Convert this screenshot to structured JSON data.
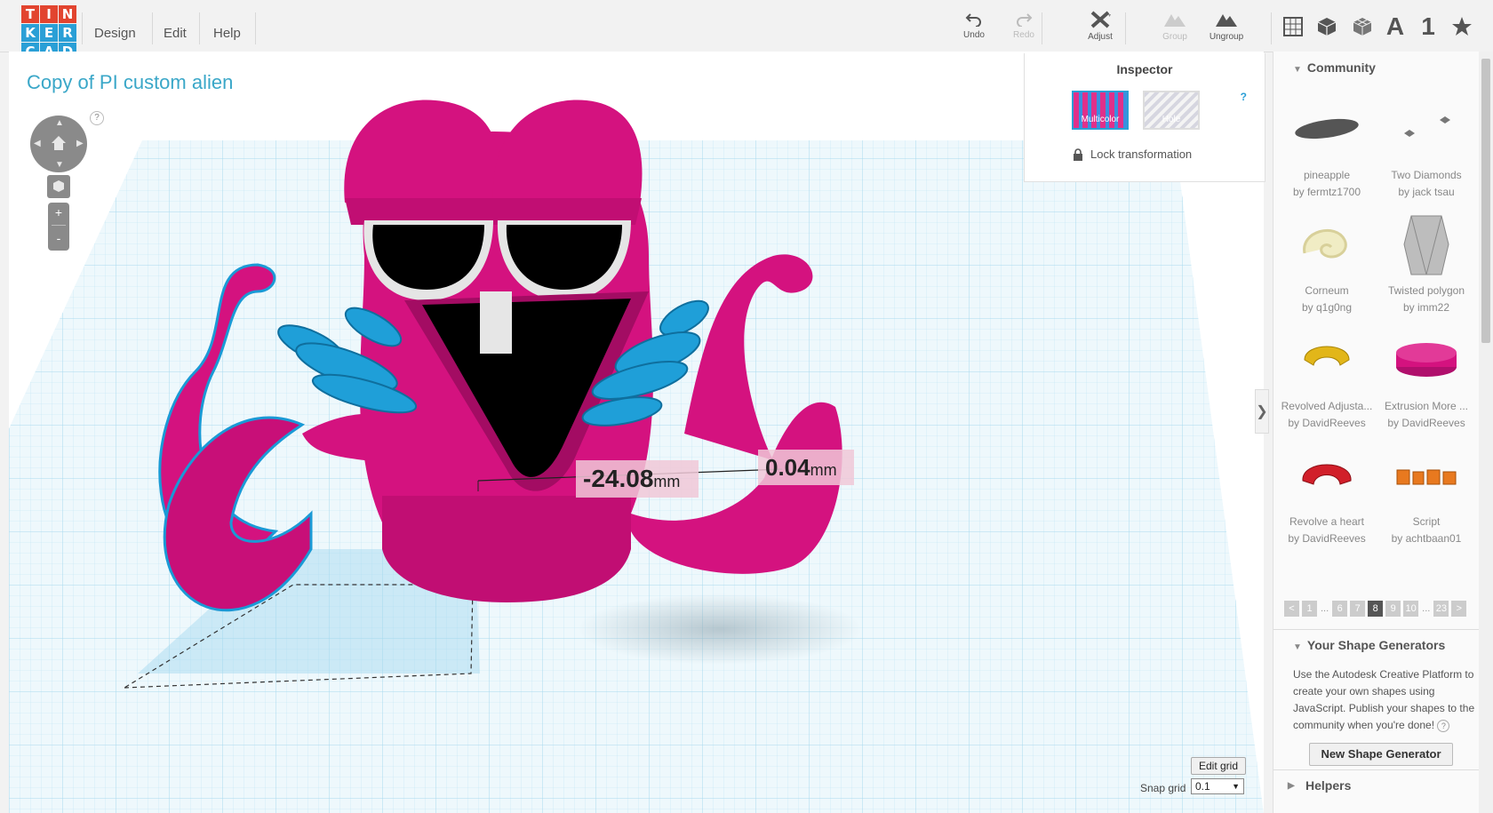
{
  "logo": {
    "letters": [
      "T",
      "I",
      "N",
      "K",
      "E",
      "R",
      "C",
      "A",
      "D"
    ],
    "colors": [
      "#e2442f",
      "#e2442f",
      "#e2442f",
      "#e2442f",
      "#2a9fd6",
      "#2a9fd6",
      "#2a9fd6",
      "#2a9fd6",
      "#2a9fd6"
    ]
  },
  "menu": {
    "design": "Design",
    "edit": "Edit",
    "help": "Help"
  },
  "toolbar": {
    "undo": "Undo",
    "redo": "Redo",
    "adjust": "Adjust",
    "group": "Group",
    "ungroup": "Ungroup"
  },
  "view_icons": {
    "letter": "A",
    "number": "1"
  },
  "design_title": "Copy of PI custom alien",
  "dimensions": {
    "x_value": "-24.08",
    "y_value": "0.04",
    "unit": "mm"
  },
  "inspector": {
    "title": "Inspector",
    "multicolor": "Multicolor",
    "hole": "Hole",
    "help": "?",
    "lock": "Lock transformation"
  },
  "grid": {
    "edit_button": "Edit grid",
    "snap_label": "Snap grid",
    "snap_value": "0.1"
  },
  "sidebar": {
    "community_title": "Community",
    "shapes": [
      {
        "name": "pineapple",
        "author": "by fermtz1700"
      },
      {
        "name": "Two Diamonds",
        "author": "by jack tsau"
      },
      {
        "name": "Corneum",
        "author": "by q1g0ng"
      },
      {
        "name": "Twisted polygon",
        "author": "by imm22"
      },
      {
        "name": "Revolved Adjusta...",
        "author": "by DavidReeves"
      },
      {
        "name": "Extrusion More ...",
        "author": "by DavidReeves"
      },
      {
        "name": "Revolve a heart",
        "author": "by DavidReeves"
      },
      {
        "name": "Script",
        "author": "by achtbaan01"
      }
    ],
    "pager": [
      "<",
      "1",
      "...",
      "6",
      "7",
      "8",
      "9",
      "10",
      "...",
      "23",
      ">"
    ],
    "pager_current": "8",
    "generators_title": "Your Shape Generators",
    "generators_text": "Use the Autodesk Creative Platform to create your own shapes using JavaScript. Publish your shapes to the community when you're done!",
    "generators_help": "?",
    "new_generator": "New Shape Generator",
    "helpers_title": "Helpers"
  },
  "colors": {
    "accent": "#2a9fd6",
    "alien": "#d4127f",
    "hands": "#1f9fd8",
    "grid": "#bfe4f3"
  }
}
